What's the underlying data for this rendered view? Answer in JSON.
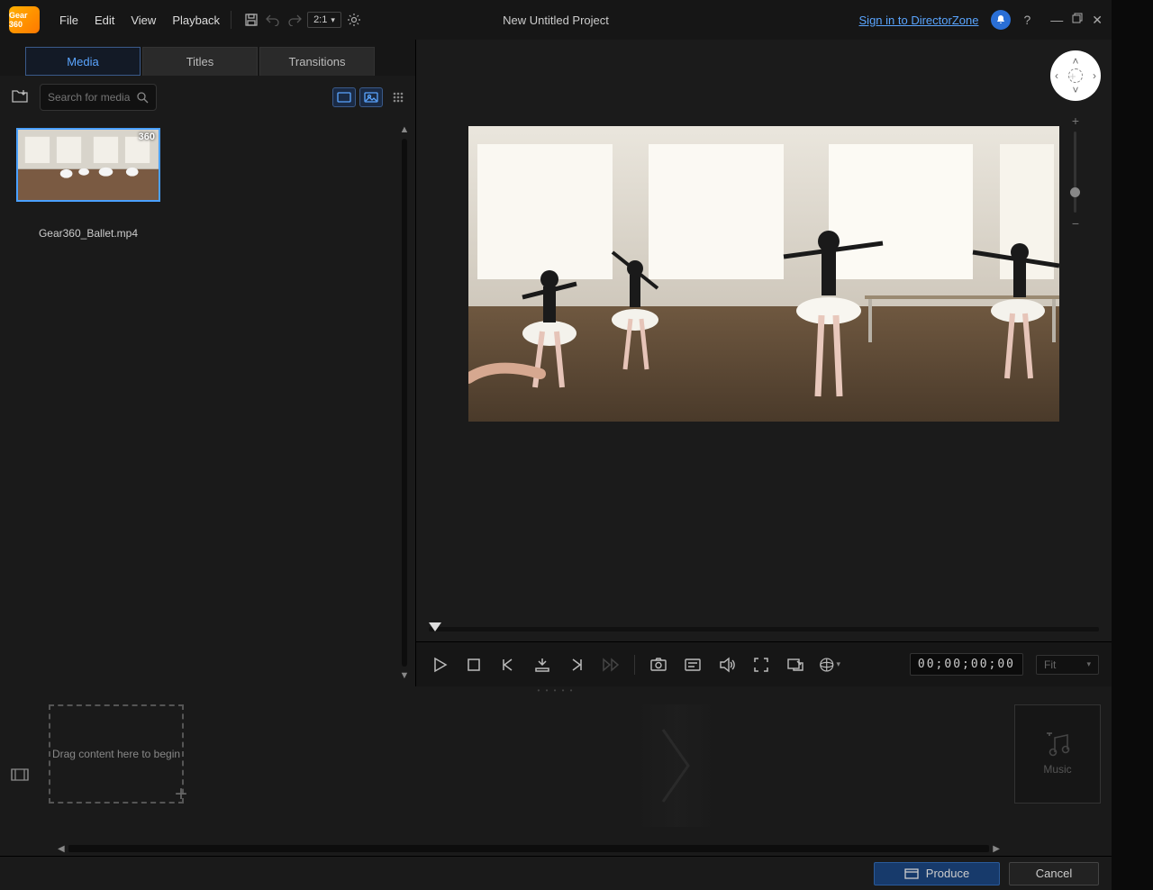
{
  "app": {
    "logo_text": "Gear 360",
    "title": "New Untitled Project"
  },
  "menu": {
    "file": "File",
    "edit": "Edit",
    "view": "View",
    "playback": "Playback",
    "aspect": "2:1"
  },
  "topbar": {
    "signin": "Sign in to DirectorZone"
  },
  "tabs": {
    "media": "Media",
    "titles": "Titles",
    "transitions": "Transitions"
  },
  "media": {
    "search_placeholder": "Search for media",
    "item": {
      "label": "Gear360_Ballet.mp4",
      "badge": "360"
    }
  },
  "playback_bar": {
    "timecode": "00;00;00;00",
    "fit": "Fit"
  },
  "timeline": {
    "drop_hint": "Drag content here to begin",
    "music": "Music"
  },
  "footer": {
    "produce": "Produce",
    "cancel": "Cancel"
  }
}
